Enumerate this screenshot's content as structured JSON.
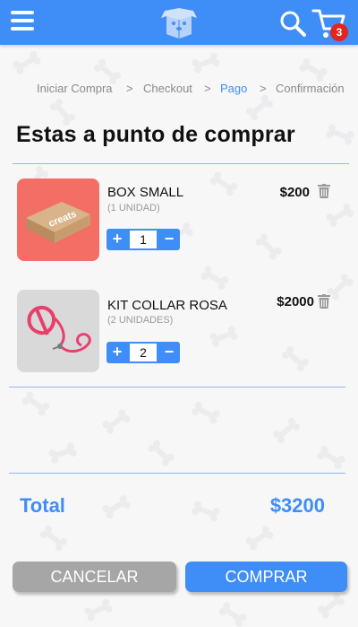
{
  "header": {
    "menu_icon": "hamburger-menu-icon",
    "logo_icon": "dog-box-logo-icon",
    "search_icon": "search-icon",
    "cart_icon": "cart-icon",
    "cart_count": "3"
  },
  "breadcrumb": {
    "steps": [
      "Iniciar Compra",
      "Checkout",
      "Pago",
      "Confirmación"
    ],
    "separator": ">",
    "active_step": "Pago"
  },
  "page_title": "Estas a punto de comprar",
  "cart": {
    "items": [
      {
        "name": "BOX SMALL",
        "units": "(1 UNIDAD)",
        "price": "$200",
        "quantity": "1",
        "image_label": "creats"
      },
      {
        "name": "KIT COLLAR ROSA",
        "units": "(2 UNIDADES)",
        "price": "$2000",
        "quantity": "2"
      }
    ],
    "stepper_plus": "+",
    "stepper_minus": "−"
  },
  "total": {
    "label": "Total",
    "value": "$3200"
  },
  "actions": {
    "cancel_label": "CANCELAR",
    "buy_label": "COMPRAR"
  },
  "colors": {
    "primary": "#3f8ef7",
    "cancel": "#a6a6a6",
    "badge": "#e0261f"
  }
}
